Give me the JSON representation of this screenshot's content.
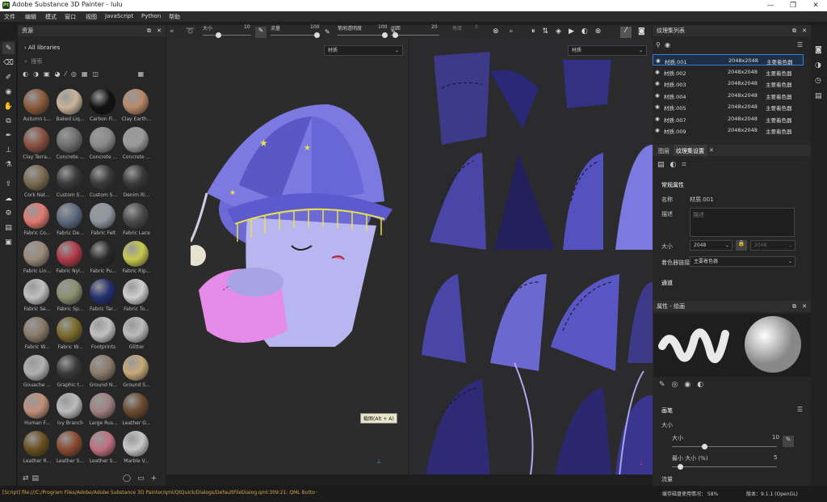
{
  "titlebar": {
    "title": "Adobe Substance 3D Painter - lulu",
    "app_icon": "Pt"
  },
  "menu": [
    "文件",
    "编辑",
    "模式",
    "窗口",
    "视图",
    "JavaScript",
    "Python",
    "帮助"
  ],
  "assets": {
    "title": "资源",
    "library": "All libraries",
    "search_placeholder": "搜索",
    "items": [
      "Autumn L...",
      "Baked Liq...",
      "Carbon Fi...",
      "Clay Earth...",
      "Clay Terra...",
      "Concrete ...",
      "Concrete ...",
      "Concrete ...",
      "Cork Nat...",
      "Custom S...",
      "Custom S...",
      "Denim Ri...",
      "Fabric Co...",
      "Fabric De...",
      "Fabric Felt",
      "Fabric Lace",
      "Fabric Lin...",
      "Fabric Nyl...",
      "Fabric Pu...",
      "Fabric Rip...",
      "Fabric Se...",
      "Fabric Sp...",
      "Fabric Tar...",
      "Fabric To...",
      "Fabric W...",
      "Fabric W...",
      "Footprints",
      "Glitter",
      "Gouache ...",
      "Graphic t...",
      "Ground N...",
      "Ground S...",
      "Human F...",
      "Ivy Branch",
      "Large Rus...",
      "Leather G...",
      "Leather R...",
      "Leather S...",
      "Leather S...",
      "Marble V..."
    ],
    "colors": [
      "#8a5a3a",
      "#c9b49a",
      "#111111",
      "#b8896a",
      "#8a5040",
      "#6e6e6e",
      "#8a8a8a",
      "#9a9a9a",
      "#7a6a50",
      "#3a3a3a",
      "#3a3a3a",
      "#3a3a3a",
      "#e07a70",
      "#5a6a80",
      "#8e96a0",
      "#4a4a4a",
      "#9a8a7a",
      "#b03a48",
      "#2a2a2a",
      "#c8c850",
      "#c0c0c0",
      "#8a9070",
      "#253070",
      "#cfcfcf",
      "#8a7a6a",
      "#7a6a2a",
      "#c0c0c0",
      "#bbbbbb",
      "#b0b0b0",
      "#3a3a3a",
      "#8a7a6a",
      "#c8a878",
      "#c09078",
      "#bbbbbb",
      "#a08080",
      "#6a4a30",
      "#6a5020",
      "#8a4a30",
      "#c07080",
      "#c8c8c8"
    ]
  },
  "toolbar": {
    "size_label": "大小",
    "size_val": "10",
    "flow_label": "流量",
    "flow_val": "100",
    "opacity_label": "笔刷透明度",
    "opacity_val": "100",
    "spacing_label": "间距",
    "spacing_val": "20",
    "angle_label": "角度",
    "angle_val": "0"
  },
  "viewport": {
    "mode3d": "材质",
    "mode2d": "材质",
    "tooltip": "截图(Alt + A)"
  },
  "texset_list": {
    "title": "纹理集列表",
    "rows": [
      {
        "name": "材质.001",
        "res": "2048x2048",
        "shader": "主要着色器"
      },
      {
        "name": "材质.002",
        "res": "2048x2048",
        "shader": "主要着色器"
      },
      {
        "name": "材质.003",
        "res": "2048x2048",
        "shader": "主要着色器"
      },
      {
        "name": "材质.004",
        "res": "2048x2048",
        "shader": "主要着色器"
      },
      {
        "name": "材质.005",
        "res": "2048x2048",
        "shader": "主要着色器"
      },
      {
        "name": "材质.007",
        "res": "2048x2048",
        "shader": "主要着色器"
      },
      {
        "name": "材质.009",
        "res": "2048x2048",
        "shader": "主要着色器"
      }
    ]
  },
  "settings": {
    "tab_layers": "图层",
    "tab_tex": "纹理集设置",
    "section": "常规属性",
    "name_label": "名称",
    "name_val": "材质.001",
    "desc_label": "描述",
    "desc_placeholder": "描述",
    "size_label": "大小",
    "size_val": "2048",
    "size2": "2048",
    "shader_label": "着色器链接",
    "shader_val": "主要着色器",
    "channels": "通道"
  },
  "props": {
    "title": "属性 - 绘画",
    "brush": "画笔",
    "size": "大小",
    "size_sub": "大小",
    "size_val": "10",
    "min_label": "最小 大小 (%)",
    "min_val": "5",
    "flow": "流量"
  },
  "status": {
    "script": "[Script] file:///C:/Program Files/Adobe/Adobe Substance 3D Painter/qml/QtQuick/Dialogs/DefaultFileDialog.qml:309:21: QML Butto··",
    "cache": "缓存磁盘使用情况： 58%",
    "version": "版本：9.1.1 (OpenGL)"
  }
}
